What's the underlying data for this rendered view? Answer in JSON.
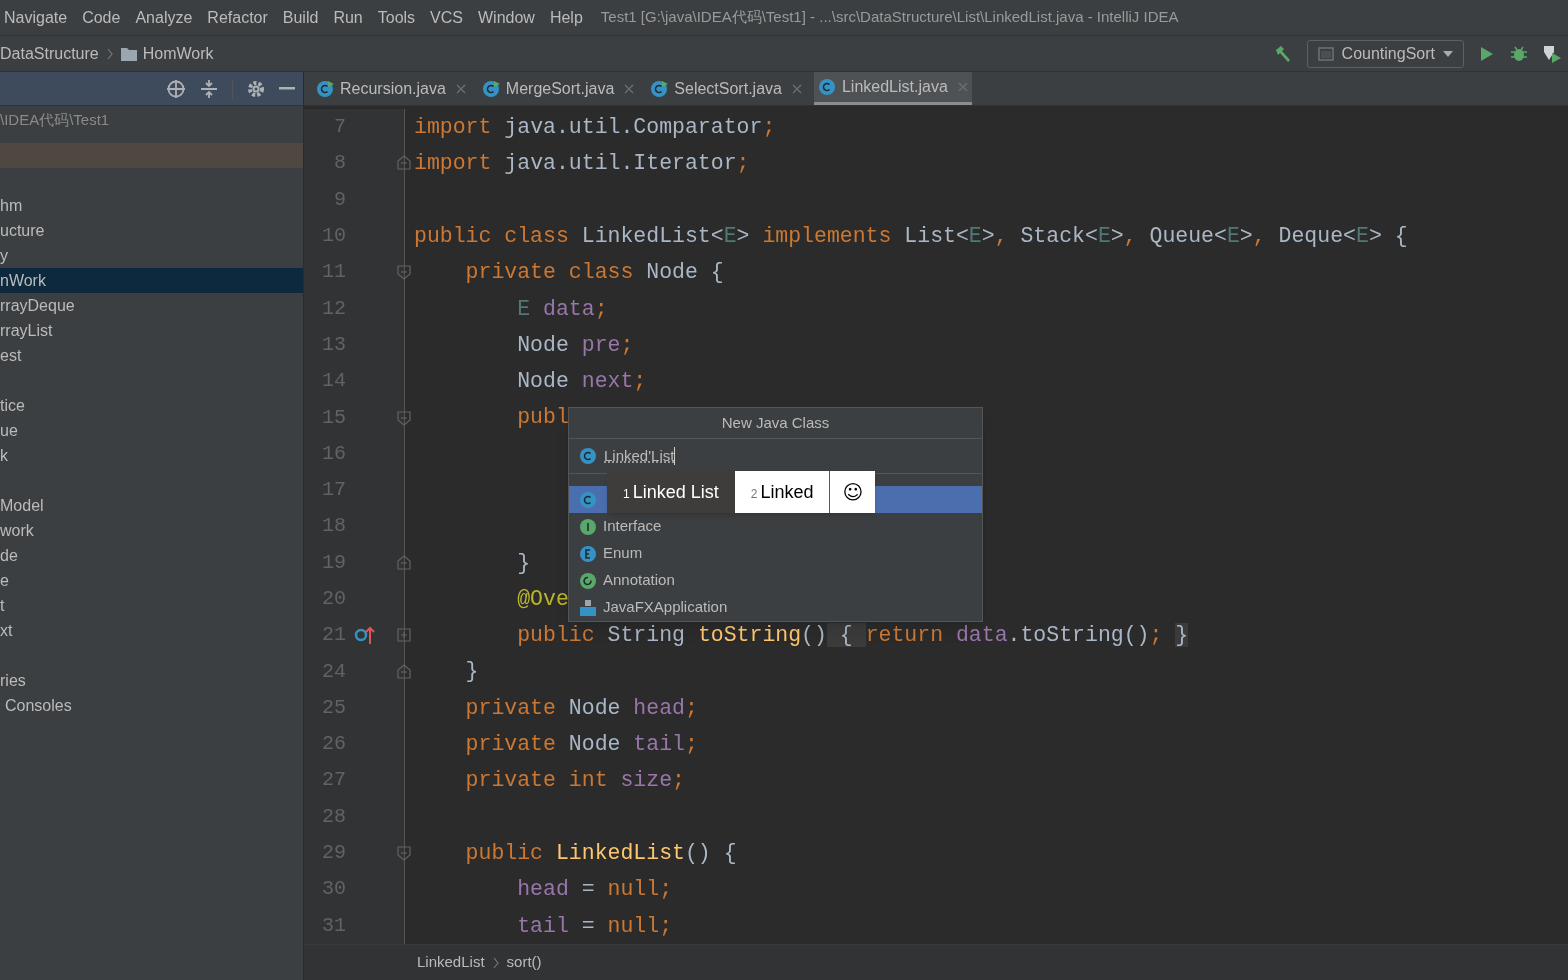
{
  "menu": [
    {
      "label": "Navigate"
    },
    {
      "label": "Code"
    },
    {
      "label": "Analyze"
    },
    {
      "label": "Refactor"
    },
    {
      "label": "Build"
    },
    {
      "label": "Run"
    },
    {
      "label": "Tools"
    },
    {
      "label": "VCS"
    },
    {
      "label": "Window"
    },
    {
      "label": "Help"
    }
  ],
  "window": {
    "title": "Test1 [G:\\java\\IDEA代码\\Test1] - ...\\src\\DataStructure\\List\\LinkedList.java - IntelliJ IDEA"
  },
  "breadcrumb": [
    {
      "label": "DataStructure",
      "kind": "text"
    },
    {
      "label": "HomWork",
      "kind": "folder"
    }
  ],
  "run_config": {
    "label": "CountingSort"
  },
  "sidebar": {
    "path": "\\IDEA代码\\Test1",
    "groups": [
      [
        {
          "label": "hm",
          "selected": false
        },
        {
          "label": "ucture",
          "selected": false
        },
        {
          "label": "y",
          "selected": false
        },
        {
          "label": "nWork",
          "selected": true
        },
        {
          "label": "rrayDeque",
          "selected": false
        },
        {
          "label": "rrayList",
          "selected": false
        },
        {
          "label": "est",
          "selected": false
        }
      ],
      [
        {
          "label": "tice",
          "selected": false
        },
        {
          "label": "ue",
          "selected": false
        },
        {
          "label": "k",
          "selected": false
        }
      ],
      [
        {
          "label": "Model",
          "selected": false
        },
        {
          "label": "work",
          "selected": false
        },
        {
          "label": "de",
          "selected": false
        },
        {
          "label": "e",
          "selected": false
        },
        {
          "label": "t",
          "selected": false
        },
        {
          "label": "xt",
          "selected": false
        }
      ],
      [
        {
          "label": "ries",
          "selected": false
        },
        {
          "label": "Consoles",
          "selected": false
        }
      ]
    ]
  },
  "tabs": [
    {
      "label": "Recursion.java",
      "selected": false,
      "runnable": true
    },
    {
      "label": "MergeSort.java",
      "selected": false,
      "runnable": true
    },
    {
      "label": "SelectSort.java",
      "selected": false,
      "runnable": true
    },
    {
      "label": "LinkedList.java",
      "selected": true,
      "runnable": false
    }
  ],
  "code": [
    {
      "number": "7",
      "kind": "plain",
      "marker": false,
      "tokens": [
        {
          "text": "import ",
          "kind": "kw"
        },
        {
          "text": "java.util.Comparator",
          "kind": "plain"
        },
        {
          "text": ";",
          "kind": "kw"
        }
      ]
    },
    {
      "number": "8",
      "kind": "fold-end",
      "marker": false,
      "tokens": [
        {
          "text": "import ",
          "kind": "kw"
        },
        {
          "text": "java.util.Iterator",
          "kind": "plain"
        },
        {
          "text": ";",
          "kind": "kw"
        }
      ]
    },
    {
      "number": "9",
      "kind": "plain",
      "marker": false
    },
    {
      "number": "10",
      "kind": "plain",
      "marker": false,
      "tokens": [
        {
          "text": "public class ",
          "kind": "kw"
        },
        {
          "text": "LinkedList<",
          "kind": "plain"
        },
        {
          "text": "E",
          "kind": "tparam"
        },
        {
          "text": "> ",
          "kind": "plain"
        },
        {
          "text": "implements ",
          "kind": "kw"
        },
        {
          "text": "List<",
          "kind": "plain"
        },
        {
          "text": "E",
          "kind": "tparam"
        },
        {
          "text": ">",
          "kind": "plain"
        },
        {
          "text": ", ",
          "kind": "kw"
        },
        {
          "text": "Stack<",
          "kind": "plain"
        },
        {
          "text": "E",
          "kind": "tparam"
        },
        {
          "text": ">",
          "kind": "plain"
        },
        {
          "text": ", ",
          "kind": "kw"
        },
        {
          "text": "Queue<",
          "kind": "plain"
        },
        {
          "text": "E",
          "kind": "tparam"
        },
        {
          "text": ">",
          "kind": "plain"
        },
        {
          "text": ", ",
          "kind": "kw"
        },
        {
          "text": "Deque<",
          "kind": "plain"
        },
        {
          "text": "E",
          "kind": "tparam"
        },
        {
          "text": "> {",
          "kind": "plain"
        }
      ]
    },
    {
      "number": "11",
      "kind": "fold-start",
      "marker": false,
      "tokens": [
        {
          "text": "    private class ",
          "kind": "kw"
        },
        {
          "text": "Node {",
          "kind": "plain"
        }
      ]
    },
    {
      "number": "12",
      "kind": "plain",
      "marker": false,
      "tokens": [
        {
          "text": "        E ",
          "kind": "tparam"
        },
        {
          "text": "data",
          "kind": "field"
        },
        {
          "text": ";",
          "kind": "kw"
        }
      ]
    },
    {
      "number": "13",
      "kind": "plain",
      "marker": false,
      "tokens": [
        {
          "text": "        Node ",
          "kind": "plain"
        },
        {
          "text": "pre",
          "kind": "field"
        },
        {
          "text": ";",
          "kind": "kw"
        }
      ]
    },
    {
      "number": "14",
      "kind": "plain",
      "marker": false,
      "tokens": [
        {
          "text": "        Node ",
          "kind": "plain"
        },
        {
          "text": "next",
          "kind": "field"
        },
        {
          "text": ";",
          "kind": "kw"
        }
      ]
    },
    {
      "number": "15",
      "kind": "fold-start",
      "marker": false,
      "tokens": [
        {
          "text": "        publ",
          "kind": "kw"
        }
      ]
    },
    {
      "number": "16",
      "kind": "plain",
      "marker": false
    },
    {
      "number": "17",
      "kind": "plain",
      "marker": false
    },
    {
      "number": "18",
      "kind": "plain",
      "marker": false
    },
    {
      "number": "19",
      "kind": "fold-end",
      "marker": false,
      "tokens": [
        {
          "text": "        }",
          "kind": "plain"
        }
      ]
    },
    {
      "number": "20",
      "kind": "plain",
      "marker": false,
      "tokens": [
        {
          "text": "        @Ove",
          "kind": "annotation"
        }
      ]
    },
    {
      "number": "21",
      "kind": "folded",
      "marker": true,
      "tokens": [
        {
          "text": "        public ",
          "kind": "kw"
        },
        {
          "text": "String ",
          "kind": "plain"
        },
        {
          "text": "toString",
          "kind": "method"
        },
        {
          "text": "()",
          "kind": "plain"
        },
        {
          "text": " { ",
          "kind": "folded"
        },
        {
          "text": "return ",
          "kind": "kw"
        },
        {
          "text": "data",
          "kind": "field"
        },
        {
          "text": ".toString()",
          "kind": "plain"
        },
        {
          "text": "; ",
          "kind": "kw"
        },
        {
          "text": "}",
          "kind": "folded"
        }
      ]
    },
    {
      "number": "24",
      "kind": "fold-end",
      "marker": false,
      "tokens": [
        {
          "text": "    }",
          "kind": "plain"
        }
      ]
    },
    {
      "number": "25",
      "kind": "plain",
      "marker": false,
      "tokens": [
        {
          "text": "    private ",
          "kind": "kw"
        },
        {
          "text": "Node ",
          "kind": "plain"
        },
        {
          "text": "head",
          "kind": "field"
        },
        {
          "text": ";",
          "kind": "kw"
        }
      ]
    },
    {
      "number": "26",
      "kind": "plain",
      "marker": false,
      "tokens": [
        {
          "text": "    private ",
          "kind": "kw"
        },
        {
          "text": "Node ",
          "kind": "plain"
        },
        {
          "text": "tail",
          "kind": "field"
        },
        {
          "text": ";",
          "kind": "kw"
        }
      ]
    },
    {
      "number": "27",
      "kind": "plain",
      "marker": false,
      "tokens": [
        {
          "text": "    private int ",
          "kind": "kw"
        },
        {
          "text": "size",
          "kind": "field"
        },
        {
          "text": ";",
          "kind": "kw"
        }
      ]
    },
    {
      "number": "28",
      "kind": "plain",
      "marker": false
    },
    {
      "number": "29",
      "kind": "fold-start",
      "marker": false,
      "tokens": [
        {
          "text": "    public ",
          "kind": "kw"
        },
        {
          "text": "LinkedList",
          "kind": "method"
        },
        {
          "text": "() {",
          "kind": "plain"
        }
      ]
    },
    {
      "number": "30",
      "kind": "plain",
      "marker": false,
      "tokens": [
        {
          "text": "        head ",
          "kind": "field"
        },
        {
          "text": "= ",
          "kind": "plain"
        },
        {
          "text": "null;",
          "kind": "kw"
        }
      ]
    },
    {
      "number": "31",
      "kind": "plain",
      "marker": false,
      "tokens": [
        {
          "text": "        tail ",
          "kind": "field"
        },
        {
          "text": "= ",
          "kind": "plain"
        },
        {
          "text": "null;",
          "kind": "kw"
        }
      ]
    }
  ],
  "dialog": {
    "title": "New Java Class",
    "value": "Linked'List",
    "items": [
      {
        "kind": "class",
        "selected": true
      },
      {
        "kind": "interface",
        "label": "Interface",
        "selected": false
      },
      {
        "kind": "enum",
        "label": "Enum",
        "selected": false
      },
      {
        "kind": "annotation",
        "label": "Annotation",
        "selected": false
      },
      {
        "kind": "javafx",
        "label": "JavaFXApplication",
        "selected": false
      }
    ]
  },
  "ime": {
    "candidates": [
      {
        "index": "1",
        "text": "Linked List",
        "selected": true
      },
      {
        "index": "2",
        "text": "Linked",
        "selected": false
      }
    ],
    "emoji": "☺"
  },
  "status_breadcrumb": [
    {
      "label": "LinkedList"
    },
    {
      "label": "sort()"
    }
  ]
}
